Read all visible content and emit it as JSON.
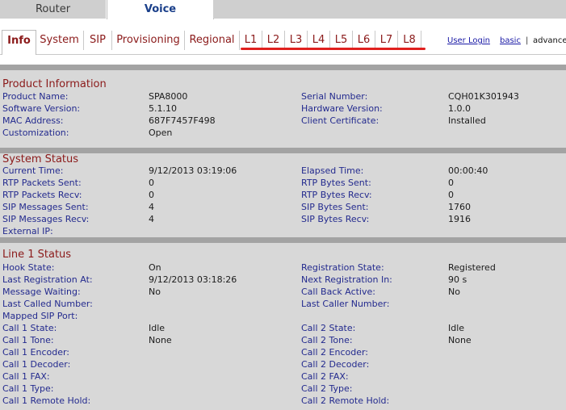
{
  "top_tabs": {
    "router": "Router",
    "voice": "Voice"
  },
  "sub_tabs": [
    "Info",
    "System",
    "SIP",
    "Provisioning",
    "Regional",
    "L1",
    "L2",
    "L3",
    "L4",
    "L5",
    "L6",
    "L7",
    "L8"
  ],
  "util": {
    "user_login": "User Login",
    "basic": "basic",
    "sep": "|",
    "advanced": "advanced"
  },
  "sections": {
    "product": {
      "title": "Product Information",
      "rows": [
        [
          "Product Name:",
          "SPA8000",
          "Serial Number:",
          "CQH01K301943"
        ],
        [
          "Software Version:",
          "5.1.10",
          "Hardware Version:",
          "1.0.0"
        ],
        [
          "MAC Address:",
          "687F7457F498",
          "Client Certificate:",
          "Installed"
        ],
        [
          "Customization:",
          "Open",
          "",
          ""
        ]
      ]
    },
    "system": {
      "title": "System Status",
      "rows": [
        [
          "Current Time:",
          "9/12/2013 03:19:06",
          "Elapsed Time:",
          "00:00:40"
        ],
        [
          "RTP Packets Sent:",
          "0",
          "RTP Bytes Sent:",
          "0"
        ],
        [
          "RTP Packets Recv:",
          "0",
          "RTP Bytes Recv:",
          "0"
        ],
        [
          "SIP Messages Sent:",
          "4",
          "SIP Bytes Sent:",
          "1760"
        ],
        [
          "SIP Messages Recv:",
          "4",
          "SIP Bytes Recv:",
          "1916"
        ],
        [
          "External IP:",
          "",
          "",
          ""
        ]
      ]
    },
    "line1": {
      "title": "Line 1 Status",
      "rows": [
        [
          "Hook State:",
          "On",
          "Registration State:",
          "Registered"
        ],
        [
          "Last Registration At:",
          "9/12/2013 03:18:26",
          "Next Registration In:",
          "90 s"
        ],
        [
          "Message Waiting:",
          "No",
          "Call Back Active:",
          "No"
        ],
        [
          "Last Called Number:",
          "",
          "Last Caller Number:",
          ""
        ],
        [
          "Mapped SIP Port:",
          "",
          "",
          ""
        ],
        [
          "Call 1 State:",
          "Idle",
          "Call 2 State:",
          "Idle"
        ],
        [
          "Call 1 Tone:",
          "None",
          "Call 2 Tone:",
          "None"
        ],
        [
          "Call 1 Encoder:",
          "",
          "Call 2 Encoder:",
          ""
        ],
        [
          "Call 1 Decoder:",
          "",
          "Call 2 Decoder:",
          ""
        ],
        [
          "Call 1 FAX:",
          "",
          "Call 2 FAX:",
          ""
        ],
        [
          "Call 1 Type:",
          "",
          "Call 2 Type:",
          ""
        ],
        [
          "Call 1 Remote Hold:",
          "",
          "Call 2 Remote Hold:",
          ""
        ]
      ]
    }
  }
}
